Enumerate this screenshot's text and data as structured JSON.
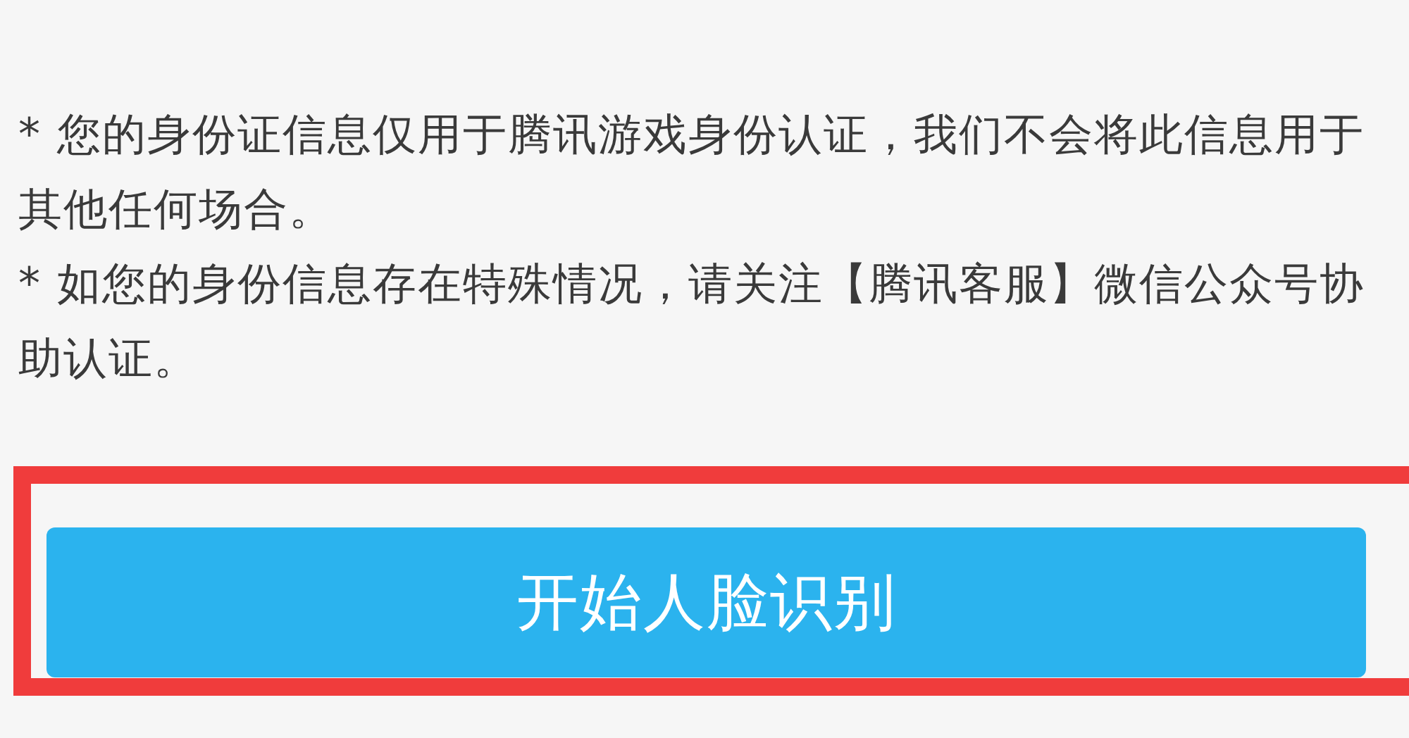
{
  "notes": [
    "* 您的身份证信息仅用于腾讯游戏身份认证，我们不会将此信息用于其他任何场合。",
    "* 如您的身份信息存在特殊情况，请关注【腾讯客服】微信公众号协助认证。"
  ],
  "button": {
    "label": "开始人脸识别"
  }
}
